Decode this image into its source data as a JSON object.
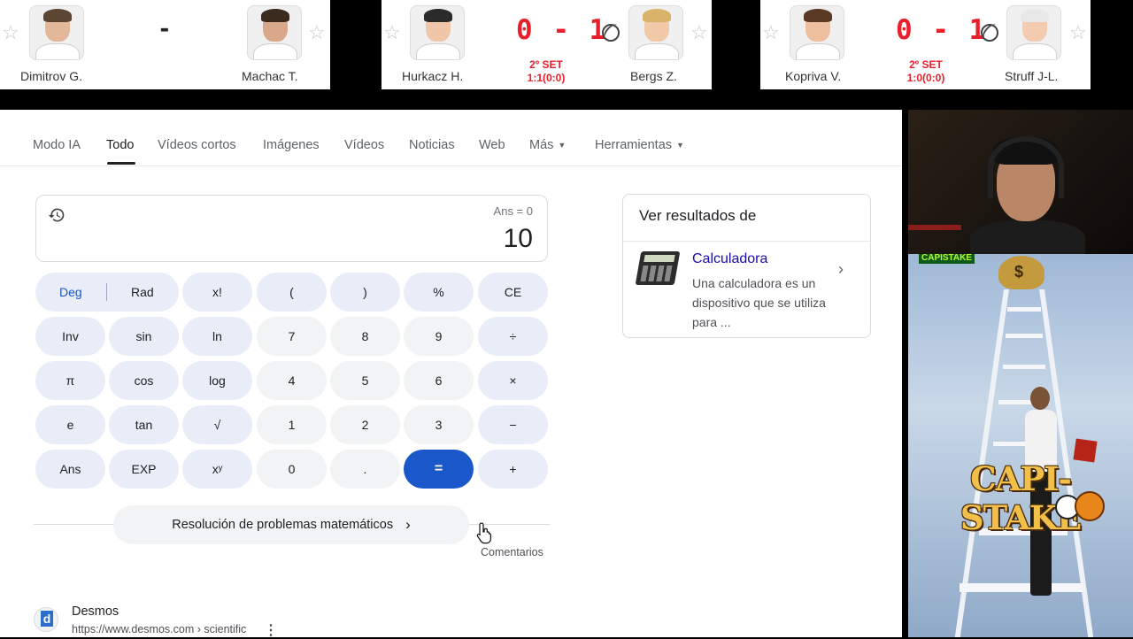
{
  "scoreboards": [
    {
      "p1": "Dimitrov G.",
      "p2": "Machac T.",
      "score": "-",
      "set": "",
      "game": ""
    },
    {
      "p1": "Hurkacz H.",
      "p2": "Bergs Z.",
      "score": "0 - 1",
      "set": "2º SET",
      "game": "1:1(0:0)"
    },
    {
      "p1": "Kopriva V.",
      "p2": "Struff J-L.",
      "score": "0 - 1",
      "set": "2º SET",
      "game": "1:0(0:0)"
    }
  ],
  "nav": {
    "tabs": [
      "Modo IA",
      "Todo",
      "Vídeos cortos",
      "Imágenes",
      "Vídeos",
      "Noticias",
      "Web",
      "Más",
      "Herramientas"
    ],
    "active": "Todo"
  },
  "calculator": {
    "ans": "Ans = 0",
    "result": "10",
    "keys": {
      "deg": "Deg",
      "rad": "Rad",
      "fact": "x!",
      "lparen": "(",
      "rparen": ")",
      "percent": "%",
      "ce": "CE",
      "inv": "Inv",
      "sin": "sin",
      "ln": "ln",
      "n7": "7",
      "n8": "8",
      "n9": "9",
      "div": "÷",
      "pi": "π",
      "cos": "cos",
      "log": "log",
      "n4": "4",
      "n5": "5",
      "n6": "6",
      "mul": "×",
      "e": "e",
      "tan": "tan",
      "sqrt": "√",
      "n1": "1",
      "n2": "2",
      "n3": "3",
      "minus": "−",
      "ansk": "Ans",
      "exp": "EXP",
      "pow": "xʸ",
      "n0": "0",
      "dot": ".",
      "eq": "=",
      "plus": "+"
    },
    "solve_label": "Resolución de problemas matemáticos",
    "comments": "Comentarios"
  },
  "result": {
    "title": "Desmos",
    "url": "https://www.desmos.com › scientific"
  },
  "side_card": {
    "heading": "Ver resultados de",
    "link": "Calculadora",
    "desc": "Una calculadora es un dispositivo que se utiliza para ..."
  },
  "promo": {
    "tag": "CAPISTAKE",
    "brand": "CAPI-STAKE"
  }
}
